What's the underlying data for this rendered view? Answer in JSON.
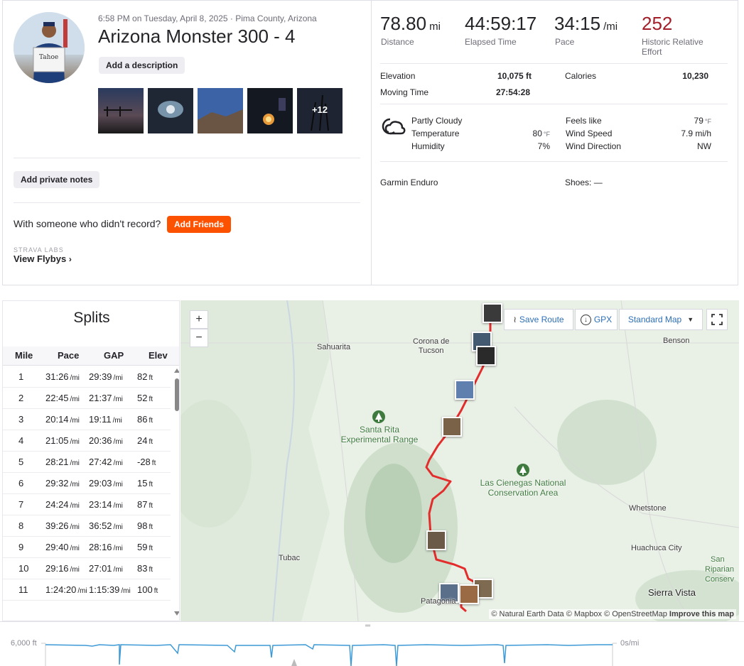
{
  "activity": {
    "datetime_location": "6:58 PM on Tuesday, April 8, 2025 · Pima County, Arizona",
    "title": "Arizona Monster 300 - 4",
    "add_description": "Add a description",
    "photo_more": "+12",
    "add_private_notes": "Add private notes",
    "friends_question": "With someone who didn't record?",
    "add_friends": "Add Friends",
    "labs_label": "STRAVA LABS",
    "view_flybys": "View Flybys",
    "avatar_sign_text": "Tahoe"
  },
  "stats": {
    "distance": {
      "value": "78.80",
      "unit": "mi",
      "label": "Distance"
    },
    "elapsed": {
      "value": "44:59:17",
      "label": "Elapsed Time"
    },
    "pace": {
      "value": "34:15",
      "unit": "/mi",
      "label": "Pace"
    },
    "effort": {
      "value": "252",
      "label": "Historic Relative Effort"
    },
    "elevation": {
      "label": "Elevation",
      "value": "10,075 ft"
    },
    "moving_time": {
      "label": "Moving Time",
      "value": "27:54:28"
    },
    "calories": {
      "label": "Calories",
      "value": "10,230"
    }
  },
  "weather": {
    "condition": "Partly Cloudy",
    "temperature_label": "Temperature",
    "temperature_value": "80",
    "temp_unit": "°F",
    "humidity_label": "Humidity",
    "humidity_value": "7%",
    "feels_like_label": "Feels like",
    "feels_like_value": "79",
    "feels_unit": "°F",
    "wind_speed_label": "Wind Speed",
    "wind_speed_value": "7.9 mi/h",
    "wind_dir_label": "Wind Direction",
    "wind_dir_value": "NW"
  },
  "gear": {
    "device": "Garmin Enduro",
    "shoes": "Shoes: —"
  },
  "splits": {
    "title": "Splits",
    "headers": [
      "Mile",
      "Pace",
      "GAP",
      "Elev"
    ],
    "rows": [
      {
        "mile": "1",
        "pace": "31:26",
        "gap": "29:39",
        "elev": "82"
      },
      {
        "mile": "2",
        "pace": "22:45",
        "gap": "21:37",
        "elev": "52"
      },
      {
        "mile": "3",
        "pace": "20:14",
        "gap": "19:11",
        "elev": "86"
      },
      {
        "mile": "4",
        "pace": "21:05",
        "gap": "20:36",
        "elev": "24"
      },
      {
        "mile": "5",
        "pace": "28:21",
        "gap": "27:42",
        "elev": "-28"
      },
      {
        "mile": "6",
        "pace": "29:32",
        "gap": "29:03",
        "elev": "15"
      },
      {
        "mile": "7",
        "pace": "24:24",
        "gap": "23:14",
        "elev": "87"
      },
      {
        "mile": "8",
        "pace": "39:26",
        "gap": "36:52",
        "elev": "98"
      },
      {
        "mile": "9",
        "pace": "29:40",
        "gap": "28:16",
        "elev": "59"
      },
      {
        "mile": "10",
        "pace": "29:16",
        "gap": "27:01",
        "elev": "83"
      },
      {
        "mile": "11",
        "pace": "1:24:20",
        "gap": "1:15:39",
        "elev": "100"
      }
    ],
    "pace_unit": "/mi",
    "elev_unit": "ft"
  },
  "map": {
    "zoom_in": "+",
    "zoom_out": "−",
    "save_route": "Save Route",
    "gpx": "GPX",
    "map_style": "Standard Map",
    "labels": {
      "sahuarita": "Sahuarita",
      "corona_1": "Corona de",
      "corona_2": "Tucson",
      "benson": "Benson",
      "santa_rita_1": "Santa Rita",
      "santa_rita_2": "Experimental Range",
      "las_cienegas_1": "Las Cienegas National",
      "las_cienegas_2": "Conservation Area",
      "whetstone": "Whetstone",
      "tubac": "Tubac",
      "huachuca": "Huachuca City",
      "sierra_vista": "Sierra Vista",
      "patagonia": "Patagonia",
      "san_1": "San",
      "san_2": "Riparian",
      "san_3": "Conserv"
    },
    "attribution": "© Natural Earth Data © Mapbox © OpenStreetMap",
    "improve": "Improve this map",
    "route_color": "#e32d2d"
  },
  "elevation_chart": {
    "y_label_left": "6,000 ft",
    "y_label_right": "0s/mi",
    "line_color": "#3d9ad6"
  }
}
